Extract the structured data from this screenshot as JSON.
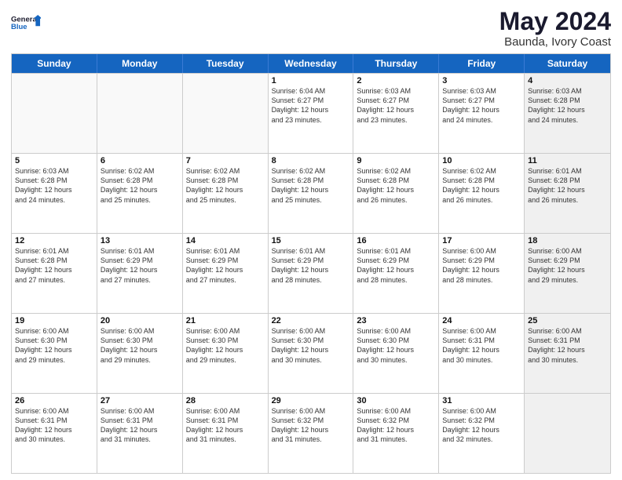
{
  "logo": {
    "line1": "General",
    "line2": "Blue"
  },
  "title": "May 2024",
  "subtitle": "Baunda, Ivory Coast",
  "weekdays": [
    "Sunday",
    "Monday",
    "Tuesday",
    "Wednesday",
    "Thursday",
    "Friday",
    "Saturday"
  ],
  "rows": [
    [
      {
        "day": "",
        "sunrise": "",
        "sunset": "",
        "daylight": "",
        "empty": true
      },
      {
        "day": "",
        "sunrise": "",
        "sunset": "",
        "daylight": "",
        "empty": true
      },
      {
        "day": "",
        "sunrise": "",
        "sunset": "",
        "daylight": "",
        "empty": true
      },
      {
        "day": "1",
        "sunrise": "Sunrise: 6:04 AM",
        "sunset": "Sunset: 6:27 PM",
        "daylight": "Daylight: 12 hours",
        "daylight2": "and 23 minutes."
      },
      {
        "day": "2",
        "sunrise": "Sunrise: 6:03 AM",
        "sunset": "Sunset: 6:27 PM",
        "daylight": "Daylight: 12 hours",
        "daylight2": "and 23 minutes."
      },
      {
        "day": "3",
        "sunrise": "Sunrise: 6:03 AM",
        "sunset": "Sunset: 6:27 PM",
        "daylight": "Daylight: 12 hours",
        "daylight2": "and 24 minutes."
      },
      {
        "day": "4",
        "sunrise": "Sunrise: 6:03 AM",
        "sunset": "Sunset: 6:28 PM",
        "daylight": "Daylight: 12 hours",
        "daylight2": "and 24 minutes.",
        "shaded": true
      }
    ],
    [
      {
        "day": "5",
        "sunrise": "Sunrise: 6:03 AM",
        "sunset": "Sunset: 6:28 PM",
        "daylight": "Daylight: 12 hours",
        "daylight2": "and 24 minutes."
      },
      {
        "day": "6",
        "sunrise": "Sunrise: 6:02 AM",
        "sunset": "Sunset: 6:28 PM",
        "daylight": "Daylight: 12 hours",
        "daylight2": "and 25 minutes."
      },
      {
        "day": "7",
        "sunrise": "Sunrise: 6:02 AM",
        "sunset": "Sunset: 6:28 PM",
        "daylight": "Daylight: 12 hours",
        "daylight2": "and 25 minutes."
      },
      {
        "day": "8",
        "sunrise": "Sunrise: 6:02 AM",
        "sunset": "Sunset: 6:28 PM",
        "daylight": "Daylight: 12 hours",
        "daylight2": "and 25 minutes."
      },
      {
        "day": "9",
        "sunrise": "Sunrise: 6:02 AM",
        "sunset": "Sunset: 6:28 PM",
        "daylight": "Daylight: 12 hours",
        "daylight2": "and 26 minutes."
      },
      {
        "day": "10",
        "sunrise": "Sunrise: 6:02 AM",
        "sunset": "Sunset: 6:28 PM",
        "daylight": "Daylight: 12 hours",
        "daylight2": "and 26 minutes."
      },
      {
        "day": "11",
        "sunrise": "Sunrise: 6:01 AM",
        "sunset": "Sunset: 6:28 PM",
        "daylight": "Daylight: 12 hours",
        "daylight2": "and 26 minutes.",
        "shaded": true
      }
    ],
    [
      {
        "day": "12",
        "sunrise": "Sunrise: 6:01 AM",
        "sunset": "Sunset: 6:28 PM",
        "daylight": "Daylight: 12 hours",
        "daylight2": "and 27 minutes."
      },
      {
        "day": "13",
        "sunrise": "Sunrise: 6:01 AM",
        "sunset": "Sunset: 6:29 PM",
        "daylight": "Daylight: 12 hours",
        "daylight2": "and 27 minutes."
      },
      {
        "day": "14",
        "sunrise": "Sunrise: 6:01 AM",
        "sunset": "Sunset: 6:29 PM",
        "daylight": "Daylight: 12 hours",
        "daylight2": "and 27 minutes."
      },
      {
        "day": "15",
        "sunrise": "Sunrise: 6:01 AM",
        "sunset": "Sunset: 6:29 PM",
        "daylight": "Daylight: 12 hours",
        "daylight2": "and 28 minutes."
      },
      {
        "day": "16",
        "sunrise": "Sunrise: 6:01 AM",
        "sunset": "Sunset: 6:29 PM",
        "daylight": "Daylight: 12 hours",
        "daylight2": "and 28 minutes."
      },
      {
        "day": "17",
        "sunrise": "Sunrise: 6:00 AM",
        "sunset": "Sunset: 6:29 PM",
        "daylight": "Daylight: 12 hours",
        "daylight2": "and 28 minutes."
      },
      {
        "day": "18",
        "sunrise": "Sunrise: 6:00 AM",
        "sunset": "Sunset: 6:29 PM",
        "daylight": "Daylight: 12 hours",
        "daylight2": "and 29 minutes.",
        "shaded": true
      }
    ],
    [
      {
        "day": "19",
        "sunrise": "Sunrise: 6:00 AM",
        "sunset": "Sunset: 6:30 PM",
        "daylight": "Daylight: 12 hours",
        "daylight2": "and 29 minutes."
      },
      {
        "day": "20",
        "sunrise": "Sunrise: 6:00 AM",
        "sunset": "Sunset: 6:30 PM",
        "daylight": "Daylight: 12 hours",
        "daylight2": "and 29 minutes."
      },
      {
        "day": "21",
        "sunrise": "Sunrise: 6:00 AM",
        "sunset": "Sunset: 6:30 PM",
        "daylight": "Daylight: 12 hours",
        "daylight2": "and 29 minutes."
      },
      {
        "day": "22",
        "sunrise": "Sunrise: 6:00 AM",
        "sunset": "Sunset: 6:30 PM",
        "daylight": "Daylight: 12 hours",
        "daylight2": "and 30 minutes."
      },
      {
        "day": "23",
        "sunrise": "Sunrise: 6:00 AM",
        "sunset": "Sunset: 6:30 PM",
        "daylight": "Daylight: 12 hours",
        "daylight2": "and 30 minutes."
      },
      {
        "day": "24",
        "sunrise": "Sunrise: 6:00 AM",
        "sunset": "Sunset: 6:31 PM",
        "daylight": "Daylight: 12 hours",
        "daylight2": "and 30 minutes."
      },
      {
        "day": "25",
        "sunrise": "Sunrise: 6:00 AM",
        "sunset": "Sunset: 6:31 PM",
        "daylight": "Daylight: 12 hours",
        "daylight2": "and 30 minutes.",
        "shaded": true
      }
    ],
    [
      {
        "day": "26",
        "sunrise": "Sunrise: 6:00 AM",
        "sunset": "Sunset: 6:31 PM",
        "daylight": "Daylight: 12 hours",
        "daylight2": "and 30 minutes."
      },
      {
        "day": "27",
        "sunrise": "Sunrise: 6:00 AM",
        "sunset": "Sunset: 6:31 PM",
        "daylight": "Daylight: 12 hours",
        "daylight2": "and 31 minutes."
      },
      {
        "day": "28",
        "sunrise": "Sunrise: 6:00 AM",
        "sunset": "Sunset: 6:31 PM",
        "daylight": "Daylight: 12 hours",
        "daylight2": "and 31 minutes."
      },
      {
        "day": "29",
        "sunrise": "Sunrise: 6:00 AM",
        "sunset": "Sunset: 6:32 PM",
        "daylight": "Daylight: 12 hours",
        "daylight2": "and 31 minutes."
      },
      {
        "day": "30",
        "sunrise": "Sunrise: 6:00 AM",
        "sunset": "Sunset: 6:32 PM",
        "daylight": "Daylight: 12 hours",
        "daylight2": "and 31 minutes."
      },
      {
        "day": "31",
        "sunrise": "Sunrise: 6:00 AM",
        "sunset": "Sunset: 6:32 PM",
        "daylight": "Daylight: 12 hours",
        "daylight2": "and 32 minutes."
      },
      {
        "day": "",
        "sunrise": "",
        "sunset": "",
        "daylight": "",
        "empty": true,
        "shaded": true
      }
    ]
  ]
}
